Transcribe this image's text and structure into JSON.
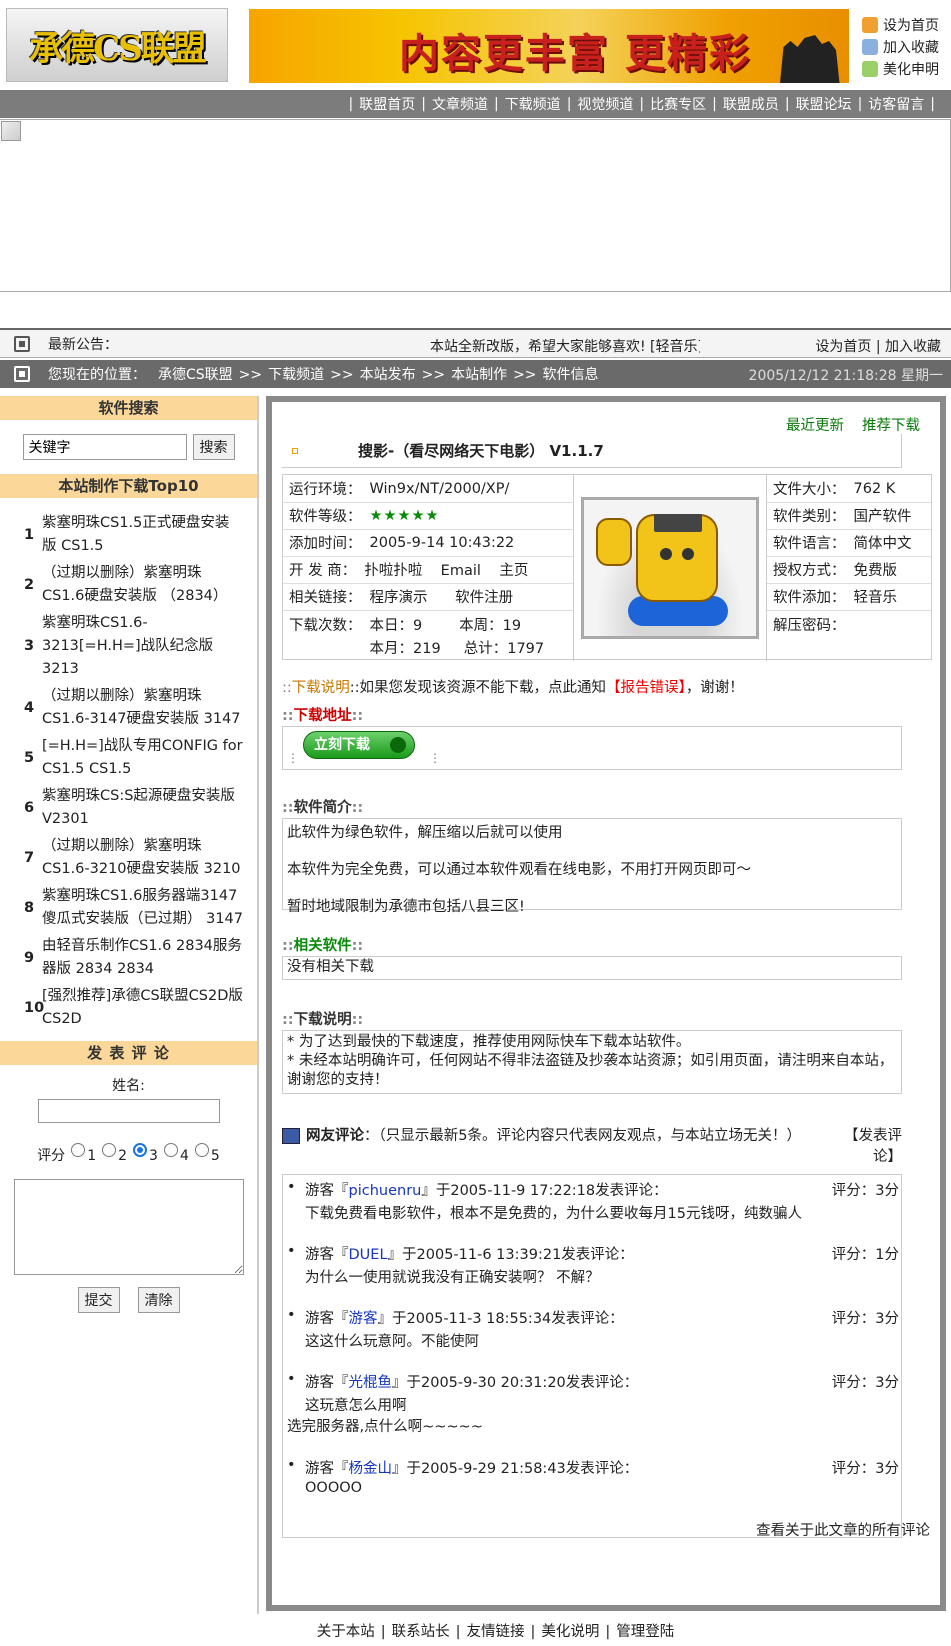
{
  "header": {
    "logo_text": "承德CS联盟",
    "banner_text": "内容更丰富 更精彩",
    "top_links": [
      {
        "label": "设为首页",
        "icon": "home-icon"
      },
      {
        "label": "加入收藏",
        "icon": "bookmark-icon"
      },
      {
        "label": "美化申明",
        "icon": "paint-icon"
      }
    ]
  },
  "nav": {
    "items": [
      "联盟首页",
      "文章频道",
      "下载频道",
      "视觉频道",
      "比赛专区",
      "联盟成员",
      "联盟论坛",
      "访客留言"
    ],
    "separator": "|"
  },
  "notice": {
    "label": "最新公告：",
    "marquee": "本站全新改版，希望大家能够喜欢!  [轻音乐]",
    "right_links": [
      "设为首页",
      "加入收藏"
    ]
  },
  "location": {
    "label": "您现在的位置：",
    "crumbs": [
      "承德CS联盟",
      "下载频道",
      "本站发布",
      "本站制作",
      "软件信息"
    ],
    "sep": ">>",
    "datetime": "2005/12/12 21:18:28 星期一"
  },
  "sidebar": {
    "search_title": "软件搜索",
    "search_value": "关键字",
    "search_button": "搜索",
    "top10_title": "本站制作下载Top10",
    "top10": [
      {
        "n": "1",
        "t": "紫塞明珠CS1.5正式硬盘安装版 CS1.5"
      },
      {
        "n": "2",
        "t": "（过期以删除）紫塞明珠CS1.6硬盘安装版 （2834）"
      },
      {
        "n": "3",
        "t": "紫塞明珠CS1.6-3213[=H.H=]战队纪念版 3213"
      },
      {
        "n": "4",
        "t": "（过期以删除）紫塞明珠CS1.6-3147硬盘安装版 3147"
      },
      {
        "n": "5",
        "t": "[=H.H=]战队专用CONFIG for CS1.5 CS1.5"
      },
      {
        "n": "6",
        "t": "紫塞明珠CS:S起源硬盘安装版 V2301"
      },
      {
        "n": "7",
        "t": "（过期以删除）紫塞明珠CS1.6-3210硬盘安装版 3210"
      },
      {
        "n": "8",
        "t": "紫塞明珠CS1.6服务器端3147傻瓜式安装版（已过期） 3147"
      },
      {
        "n": "9",
        "t": "由轻音乐制作CS1.6 2834服务器版 2834 2834"
      },
      {
        "n": "10",
        "t": "[强烈推荐]承德CS联盟CS2D版 CS2D"
      }
    ],
    "comment_title": "发 表 评 论",
    "name_label": "姓名:",
    "rating_label": "评分",
    "rating_options": [
      "1",
      "2",
      "3",
      "4",
      "5"
    ],
    "rating_selected": "3",
    "submit": "提交",
    "clear": "清除"
  },
  "main": {
    "recent": "最近更新",
    "recommend": "推荐下载",
    "title": "搜影-（看尽网络天下电影）  V1.1.7",
    "info_left": [
      {
        "label": "运行环境：",
        "value": "Win9x/NT/2000/XP/"
      },
      {
        "label": "软件等级：",
        "value": "★★★★★"
      },
      {
        "label": "添加时间：",
        "value": "2005-9-14 10:43:22"
      },
      {
        "label": "开 发 商：",
        "value": "扑啦扑啦    Email    主页"
      },
      {
        "label": "相关链接：",
        "value": "程序演示      软件注册"
      },
      {
        "label": "下载次数：",
        "value": "本日：9        本周：19"
      }
    ],
    "download_counts_line2": "本月：219     总计：1797",
    "info_right": [
      {
        "label": "文件大小：",
        "value": "762 K"
      },
      {
        "label": "软件类别：",
        "value": "国产软件"
      },
      {
        "label": "软件语言：",
        "value": "简体中文"
      },
      {
        "label": "授权方式：",
        "value": "免费版"
      },
      {
        "label": "软件添加：",
        "value": "轻音乐"
      },
      {
        "label": "解压密码：",
        "value": ""
      }
    ],
    "report_pre": "::",
    "report_link": "下载说明",
    "report_mid": "::如果您发现该资源不能下载，点此通知",
    "report_err": "【报告错误】",
    "report_end": "，谢谢！",
    "dl_addr_title": "下载地址",
    "dl_button": "立刻下载",
    "intro_title": "软件简介",
    "intro": [
      "此软件为绿色软件，解压缩以后就可以使用",
      "本软件为完全免费，可以通过本软件观看在线电影，不用打开网页即可～",
      "暂时地域限制为承德市包括八县三区!"
    ],
    "related_title": "相关软件",
    "related": "没有相关下载",
    "notes_title": "下载说明",
    "notes": [
      "* 为了达到最快的下载速度，推荐使用网际快车下载本站软件。",
      "* 未经本站明确许可，任何网站不得非法盗链及抄袭本站资源；如引用页面，请注明来自本站，谢谢您的支持！"
    ],
    "reviews_title": "网友评论",
    "reviews_note": "：（只显示最新5条。评论内容只代表网友观点，与本站立场无关！）",
    "post_review": "【发表评论】",
    "reviews": [
      {
        "pre": "游客『",
        "user": "pichuenru",
        "post": "』于2005-11-9 17:22:18发表评论：",
        "score": "评分：3分",
        "text": "下载免费看电影软件，根本不是免费的，为什么要收每月15元钱呀，纯数骗人",
        "extra": ""
      },
      {
        "pre": "游客『",
        "user": "DUEL",
        "post": "』于2005-11-6 13:39:21发表评论：",
        "score": "评分：1分",
        "text": "为什么一使用就说我没有正确安装啊？ 不解？",
        "extra": ""
      },
      {
        "pre": "游客『",
        "user": "游客",
        "post": "』于2005-11-3 18:55:34发表评论：",
        "score": "评分：3分",
        "text": "这这什么玩意阿。不能使阿",
        "extra": ""
      },
      {
        "pre": "游客『",
        "user": "光棍鱼",
        "post": "』于2005-9-30 20:31:20发表评论：",
        "score": "评分：3分",
        "text": "这玩意怎么用啊",
        "extra": "选完服务器,点什么啊~~~~~"
      },
      {
        "pre": "游客『",
        "user": "杨金山",
        "post": "』于2005-9-29 21:58:43发表评论：",
        "score": "评分：3分",
        "text": "OOOOO",
        "extra": ""
      }
    ],
    "all_reviews": "查看关于此文章的所有评论"
  },
  "footer": {
    "links": [
      "关于本站",
      "联系站长",
      "友情链接",
      "美化说明",
      "管理登陆"
    ]
  }
}
